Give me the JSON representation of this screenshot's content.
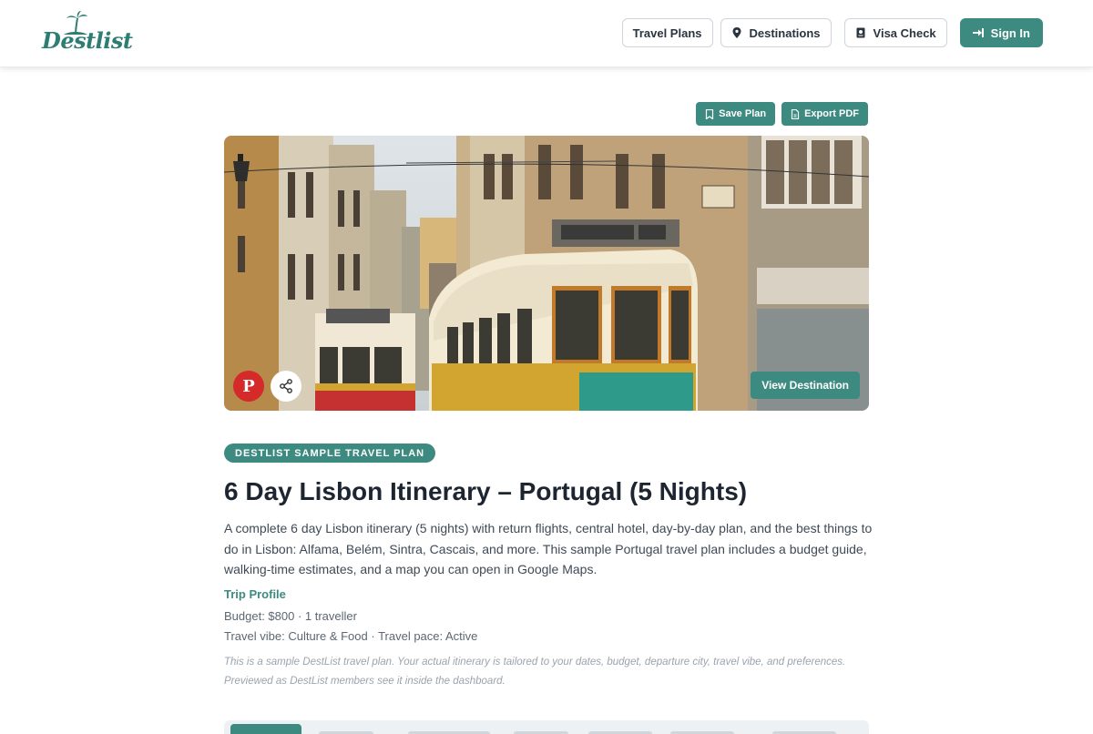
{
  "header": {
    "logo_text": "Destlist",
    "nav": {
      "travel_plans": "Travel Plans",
      "destinations": "Destinations",
      "visa_check": "Visa Check",
      "sign_in": "Sign In"
    }
  },
  "actions": {
    "save_plan": "Save Plan",
    "export_pdf": "Export PDF"
  },
  "hero": {
    "view_destination": "View Destination",
    "pinterest_icon": "pinterest-icon",
    "share_icon": "share-icon"
  },
  "plan": {
    "badge": "DESTLIST SAMPLE TRAVEL PLAN",
    "title": "6 Day Lisbon Itinerary – Portugal (5 Nights)",
    "description": "A complete 6 day Lisbon itinerary (5 nights) with return flights, central hotel, day-by-day plan, and the best things to do in Lisbon: Alfama, Belém, Sintra, Cascais, and more. This sample Portugal travel plan includes a budget guide, walking-time estimates, and a map you can open in Google Maps.",
    "profile_heading": "Trip Profile",
    "profile_budget": "Budget: $800 · 1 traveller",
    "profile_vibe": "Travel vibe: Culture & Food · Travel pace: Active",
    "note": "This is a sample DestList travel plan. Your actual itinerary is tailored to your dates, budget, departure city, travel vibe, and preferences. Previewed as DestList members see it inside the dashboard."
  },
  "colors": {
    "brand": "#3d8a80",
    "pinterest": "#d42a2a"
  }
}
